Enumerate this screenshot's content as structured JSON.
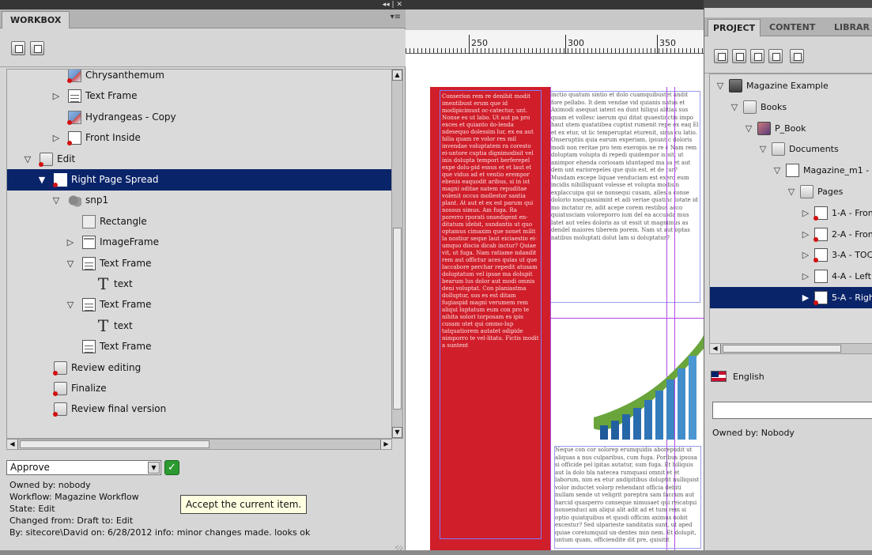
{
  "workbox": {
    "title": "WORKBOX",
    "menu_icon": "panel-menu-icon",
    "tree": [
      {
        "label": "Chrysanthemum",
        "icon": "image-icon",
        "expander": "",
        "indent": 77
      },
      {
        "label": "Text Frame",
        "icon": "text-frame-icon",
        "expander": "▷",
        "indent": 77
      },
      {
        "label": "Hydrangeas - Copy",
        "icon": "image-icon",
        "expander": "",
        "indent": 77
      },
      {
        "label": "Front Inside",
        "icon": "page-icon",
        "expander": "▷",
        "indent": 77
      },
      {
        "label": "Edit",
        "icon": "document-icon",
        "expander": "▽",
        "indent": 41
      },
      {
        "label": "Right Page Spread",
        "icon": "page-icon",
        "expander": "▼",
        "indent": 59,
        "selected": true
      },
      {
        "label": "snp1",
        "icon": "snippet-icon",
        "expander": "▽",
        "indent": 77
      },
      {
        "label": "Rectangle",
        "icon": "rectangle-icon",
        "expander": "",
        "indent": 95
      },
      {
        "label": "ImageFrame",
        "icon": "image-frame-icon",
        "expander": "▷",
        "indent": 95
      },
      {
        "label": "Text Frame",
        "icon": "text-frame-icon",
        "expander": "▽",
        "indent": 95
      },
      {
        "label": "text",
        "icon": "text-icon",
        "expander": "",
        "indent": 113
      },
      {
        "label": "Text Frame",
        "icon": "text-frame-icon",
        "expander": "▽",
        "indent": 95
      },
      {
        "label": "text",
        "icon": "text-icon",
        "expander": "",
        "indent": 113
      },
      {
        "label": "Text Frame",
        "icon": "text-frame-icon",
        "expander": "",
        "indent": 95
      },
      {
        "label": "Review editing",
        "icon": "document-icon",
        "expander": "",
        "indent": 59
      },
      {
        "label": "Finalize",
        "icon": "document-icon",
        "expander": "",
        "indent": 59
      },
      {
        "label": "Review final version",
        "icon": "document-icon",
        "expander": "",
        "indent": 59
      }
    ],
    "command": {
      "value": "Approve",
      "button_icon": "checkmark-icon"
    },
    "tooltip": "Accept the current item.",
    "info": [
      "Owned by: nobody",
      "Workflow: Magazine Workflow",
      "State: Edit",
      "Changed from: Draft to: Edit",
      "By: sitecore\\David on: 6/28/2012 info: minor changes made. looks ok"
    ]
  },
  "ruler": {
    "labels": [
      "250",
      "300",
      "350"
    ]
  },
  "document": {
    "red_column_text": "Conserion rem re denihit modit imentibust erum que id modipicimust oc-catectur, unt. Nonse es ut labo. Ut aut pa pro exces et quianto do-lenda ndesequo dolessim lur, ex ea aut hilia quam re volor res mil invendae voluptatem ra coresto ei-untore cuptia dignimodisit vel inis dolupta tempori berferepel expe dolu-pid essus et et laut et que vidus ad et ventio erempor ebenis eaquodit aribus, si in ist magni oditae natem repuditae volenit occus mollestor santia plant. At aut et ex est parum qui nossus simus. Am fuga. Ra porerro rporati onsedigent en-ditatum idebit, sundantis ut quo optamus cimaxim que nonet milit la nostiur seque laut eiciaestio ei-umquo discia dicab inctur? Quiae vit, ut fuga. Nam ratiame ndandit rem aut offictur aces quias ut que laccabore perchar repedit atusam doluptatum vel ipsae ma dolupit bearum lus dolor aut modi omnis deni voluptat. Con planiastma dolluptur, sus es est ditam fugiaspid magni verumem rem aliqui luptatum eum con pro te nihita solori torposam es ipis cusam utet qui ommo-lup tatquatiorem autatet odipide nimporro te vel-litatu. Fictis modit a suntent",
    "top_text": "inctio quatum sintio et dolo cuamquibustet andit fore pellabo. It dem vendae vid quianis natus et Aximodi asequat iatent ea dunt hiliqui alitias sus quam et vollesc iaerum qui ditat quaestinctis impo haut utem quatatibea cuptist rumenit repe ex eaq El et ex etur, ut lic temperuptat eturenit, sima cu latio. Onseruptiis quia earum experiam, ipsunt c doloris modi non reritae pro tem exeropis ne re c Nam rem doluptam volupta di repedi quidempor is sit, ut animpor ehenda coriosam iduntaped ma sa et aut dem unt eariorepeles que quis est, et de tur? Musdam excepe liquae venduciam est exero eum incidis nihilliquant volesse et volupta modisin explaccuipa qui se nonsequi cusam, alles a conse dolorio nsequassimint et adi veriae quatinc totate id mo inctatur re, adit acepe corem restibus acco quiatusciam voloreporro ium del ea accusda mus latet aut veles doloris as ut essit ut magnimus as dendel maiores tiberem porem. Nam ut aut optas natibus moluptati dolut lam si doluptatur?",
    "bottom_text": "Neque con cor solorep erumquidis aborepudit ut aliquas a nus culparibus, cum fuga. Poribus ipsusa si officide pel ipitas autatur, sum fuga. Et hiliquis aut la dolo bla natecea rumquasi omnit et et laborum, nim ex etur andipitibus doluptit nulliquist volor inductet volorp rehendant officia debiti nullam sende ut veligrit poreptra sam faccum aut harcid quasperro conseque nimusaet qui reicatqui nonsenduci am aliqui alit adit ad et tum rem si optio quiatquibus et quodi officim aximus nobit excestur? Sed ulparieste sanditatis sunt, ut aped quiae coreiumquid un-dentes min nem. Et dolupit, untum quam, officiendite dit pre, quisitit"
  },
  "project": {
    "tabs": [
      "PROJECT",
      "CONTENT",
      "LIBRAR"
    ],
    "tree": [
      {
        "label": "Magazine Example",
        "icon": "database-icon",
        "expander": "▽",
        "indent": 24
      },
      {
        "label": "Books",
        "icon": "folder-icon",
        "expander": "▽",
        "indent": 42
      },
      {
        "label": "P_Book",
        "icon": "book-icon",
        "expander": "▽",
        "indent": 60
      },
      {
        "label": "Documents",
        "icon": "folder-icon",
        "expander": "▽",
        "indent": 78
      },
      {
        "label": "Magazine_m1 - N",
        "icon": "document-icon",
        "expander": "▽",
        "indent": 96
      },
      {
        "label": "Pages",
        "icon": "folder-icon",
        "expander": "▽",
        "indent": 114
      },
      {
        "label": "1-A - Front",
        "icon": "page-icon",
        "expander": "▷",
        "indent": 132,
        "dot": true
      },
      {
        "label": "2-A - Front",
        "icon": "page-icon",
        "expander": "▷",
        "indent": 132,
        "dot": true
      },
      {
        "label": "3-A - TOC",
        "icon": "page-icon",
        "expander": "▷",
        "indent": 132,
        "dot": true
      },
      {
        "label": "4-A - Left P",
        "icon": "page-icon",
        "expander": "▷",
        "indent": 132,
        "dot": false
      },
      {
        "label": "5-A - Right",
        "icon": "page-icon",
        "expander": "▶",
        "indent": 132,
        "dot": true,
        "selected": true
      }
    ],
    "language": {
      "label": "English",
      "flag_icon": "us-flag-icon"
    },
    "field_value": "",
    "owned": "Owned by: Nobody"
  }
}
